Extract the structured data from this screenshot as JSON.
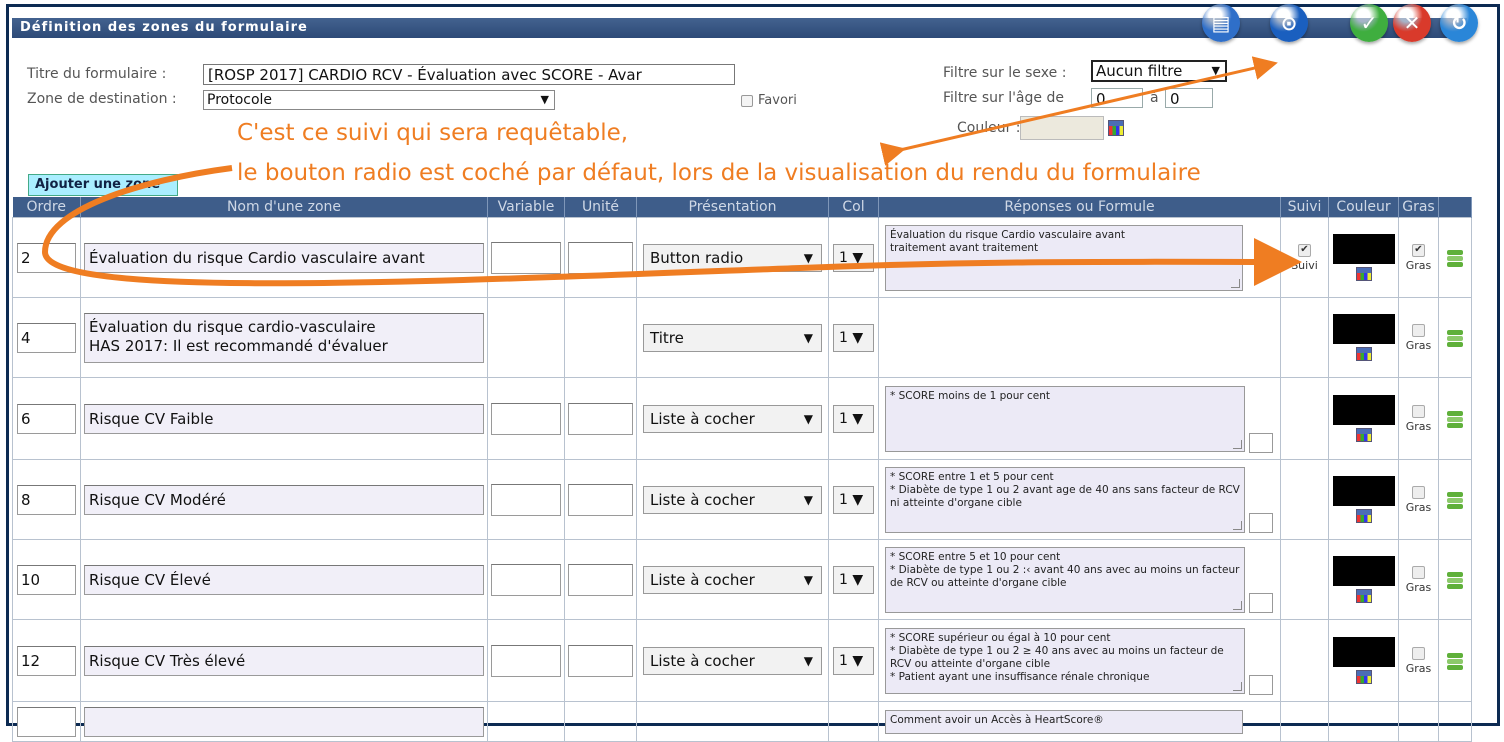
{
  "window": {
    "title": "Définition des zones du formulaire"
  },
  "toolbar": {
    "buttons": [
      {
        "name": "document-icon",
        "color": "#2f6fc9",
        "glyph": "▤"
      },
      {
        "name": "search-icon",
        "color": "#1a5fbf",
        "glyph": "⊙"
      },
      {
        "name": "validate-icon",
        "color": "#3fae3f",
        "glyph": "✓"
      },
      {
        "name": "close-icon",
        "color": "#d93a2b",
        "glyph": "✕"
      },
      {
        "name": "back-icon",
        "color": "#2a86d8",
        "glyph": "↻"
      }
    ]
  },
  "form": {
    "title_label": "Titre du formulaire :",
    "title_value": "[ROSP 2017] CARDIO  RCV - Évaluation avec SCORE - Avar",
    "destination_label": "Zone de destination :",
    "destination_value": "Protocole",
    "favori_label": "Favori",
    "sex_filter_label": "Filtre sur le sexe :",
    "sex_filter_value": "Aucun filtre",
    "age_filter_label": "Filtre sur l'âge de",
    "age_from": "0",
    "age_to_label": "à",
    "age_to": "0",
    "color_label": "Couleur :"
  },
  "annotation": {
    "line1": "C'est ce suivi qui sera requêtable,",
    "line2": "le bouton radio est coché par défaut, lors de la visualisation du rendu du formulaire",
    "color": "#ef7d22"
  },
  "add_zone_button": "Ajouter une zone",
  "table": {
    "headers": [
      "Ordre",
      "Nom d'une zone",
      "Variable",
      "Unité",
      "Présentation",
      "Col",
      "Réponses ou Formule",
      "Suivi",
      "Couleur",
      "Gras"
    ],
    "rows": [
      {
        "order": "2",
        "name": "Évaluation du risque Cardio vasculaire  avant",
        "presentation": "Button radio",
        "col": "1",
        "answers": "Évaluation du risque Cardio vasculaire  avant\ntraitement avant traitement",
        "suivi_checked": true,
        "suivi_label": "Suivi",
        "gras_checked": true,
        "gras_label": "Gras"
      },
      {
        "order": "4",
        "name": "Évaluation du risque cardio-vasculaire\nHAS 2017: Il est recommandé d'évaluer",
        "presentation": "Titre",
        "col": "1",
        "answers": "",
        "suivi_checked": false,
        "suivi_label": "",
        "gras_checked": false,
        "gras_label": "Gras"
      },
      {
        "order": "6",
        "name": "Risque CV Faible",
        "presentation": "Liste à cocher",
        "col": "1",
        "answers": "* SCORE moins de 1 pour cent",
        "suivi_checked": false,
        "suivi_label": "",
        "gras_checked": false,
        "gras_label": "Gras"
      },
      {
        "order": "8",
        "name": "Risque CV Modéré",
        "presentation": "Liste à cocher",
        "col": "1",
        "answers": "* SCORE entre 1 et 5 pour cent\n* Diabète de type 1 ou 2 avant age de  40 ans sans facteur de RCV ni atteinte d'organe cible",
        "suivi_checked": false,
        "suivi_label": "",
        "gras_checked": false,
        "gras_label": "Gras"
      },
      {
        "order": "10",
        "name": "Risque CV Élevé",
        "presentation": "Liste à cocher",
        "col": "1",
        "answers": "* SCORE entre 5 et 10 pour cent\n* Diabète de type 1 ou 2 :‹ avant 40 ans avec au moins un facteur de RCV ou atteinte d'organe cible",
        "suivi_checked": false,
        "suivi_label": "",
        "gras_checked": false,
        "gras_label": "Gras"
      },
      {
        "order": "12",
        "name": "Risque CV Très élevé",
        "presentation": "Liste à cocher",
        "col": "1",
        "answers": "* SCORE supérieur ou égal à 10 pour cent\n* Diabète de type 1 ou 2 ≥ 40 ans avec au moins un facteur de RCV ou atteinte d'organe cible\n* Patient ayant une insuffisance rénale chronique",
        "suivi_checked": false,
        "suivi_label": "",
        "gras_checked": false,
        "gras_label": "Gras"
      },
      {
        "order": "",
        "name": "",
        "presentation": "",
        "col": "",
        "answers": "Comment avoir un Accès à HeartScore®",
        "suivi_checked": false,
        "suivi_label": "",
        "gras_checked": false,
        "gras_label": ""
      }
    ]
  }
}
